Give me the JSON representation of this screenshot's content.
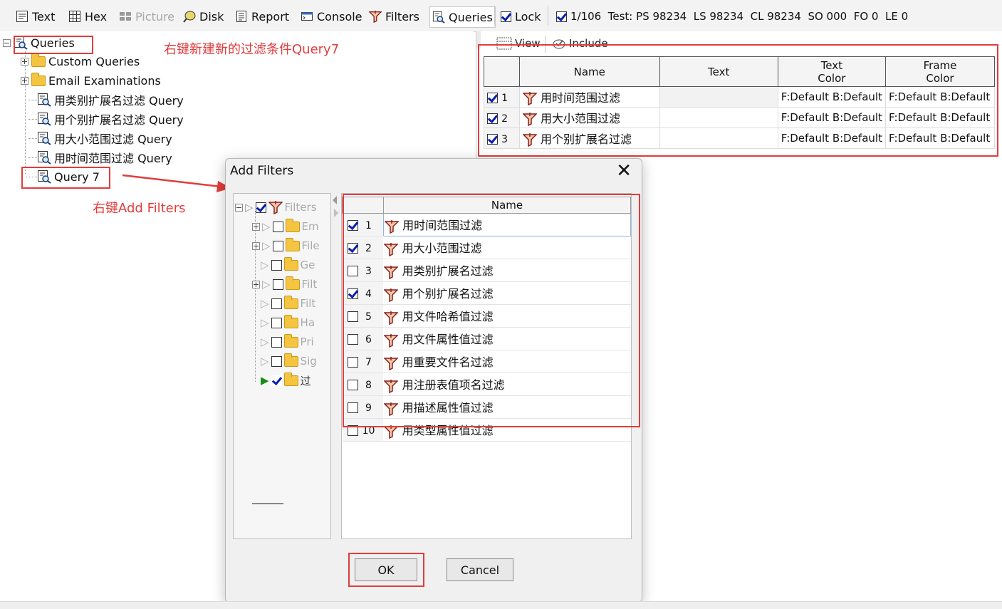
{
  "toolbar": {
    "items": [
      {
        "label": "Text",
        "icon": "text-view-icon"
      },
      {
        "label": "Hex",
        "icon": "hex-view-icon"
      },
      {
        "label": "Picture",
        "icon": "picture-view-icon"
      },
      {
        "label": "Disk",
        "icon": "disk-view-icon"
      },
      {
        "label": "Report",
        "icon": "report-view-icon"
      },
      {
        "label": "Console",
        "icon": "console-view-icon"
      },
      {
        "label": "Filters",
        "icon": "filter-icon"
      },
      {
        "label": "Queries",
        "icon": "query-icon"
      }
    ],
    "lock_label": "Lock",
    "status": "1/106  Test: PS 98234  LS 98234  CL 98234  SO 000  FO 0  LE 0"
  },
  "tree": {
    "root": "Queries",
    "items": [
      "Custom Queries",
      "Email Examinations",
      "用类别扩展名过滤 Query",
      "用个别扩展名过滤 Query",
      "用大小范围过滤 Query",
      "用时间范围过滤 Query",
      "Query 7"
    ]
  },
  "annotations": {
    "top": "右键新建新的过滤条件Query7",
    "middle": "右键Add Filters"
  },
  "right_panel": {
    "view_label": "View",
    "include_label": "Include",
    "columns": {
      "name": "Name",
      "text": "Text",
      "text_color": [
        "Text",
        "Color"
      ],
      "frame_color": [
        "Frame",
        "Color"
      ]
    },
    "rows": [
      {
        "num": "1",
        "name": "用时间范围过滤",
        "text": "",
        "text_color": "F:Default B:Default",
        "frame_color": "F:Default B:Default",
        "checked": true
      },
      {
        "num": "2",
        "name": "用大小范围过滤",
        "text": "",
        "text_color": "F:Default B:Default",
        "frame_color": "F:Default B:Default",
        "checked": true
      },
      {
        "num": "3",
        "name": "用个别扩展名过滤",
        "text": "",
        "text_color": "F:Default B:Default",
        "frame_color": "F:Default B:Default",
        "checked": true
      }
    ]
  },
  "dialog": {
    "title": "Add Filters",
    "tree_items": [
      "Filters",
      "Em",
      "File",
      "Ge",
      "Filt",
      "Filt",
      "Ha",
      "Pri",
      "Sig",
      "过"
    ],
    "list_header": "Name",
    "filters": [
      {
        "num": "1",
        "name": "用时间范围过滤",
        "checked": true
      },
      {
        "num": "2",
        "name": "用大小范围过滤",
        "checked": true
      },
      {
        "num": "3",
        "name": "用类别扩展名过滤",
        "checked": false
      },
      {
        "num": "4",
        "name": "用个别扩展名过滤",
        "checked": true
      },
      {
        "num": "5",
        "name": "用文件哈希值过滤",
        "checked": false
      },
      {
        "num": "6",
        "name": "用文件属性值过滤",
        "checked": false
      },
      {
        "num": "7",
        "name": "用重要文件名过滤",
        "checked": false
      },
      {
        "num": "8",
        "name": "用注册表值项名过滤",
        "checked": false
      },
      {
        "num": "9",
        "name": "用描述属性值过滤",
        "checked": false
      },
      {
        "num": "10",
        "name": "用类型属性值过滤",
        "checked": false
      }
    ],
    "ok_label": "OK",
    "cancel_label": "Cancel"
  },
  "colors": {
    "annotation_red": "#e23c3c",
    "check_blue": "#0a1fb0",
    "folder_yellow": "#f5c542"
  }
}
